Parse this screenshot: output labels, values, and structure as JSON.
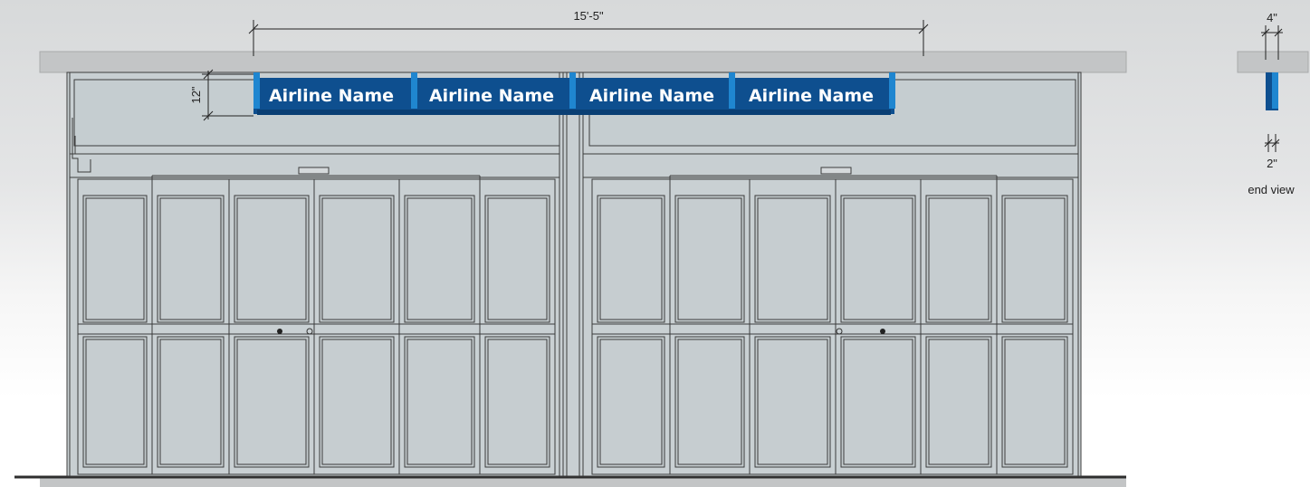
{
  "dimensions": {
    "overall_width": "15'-5\"",
    "sign_height": "12\"",
    "end_view_depth": "4\"",
    "end_view_thickness": "2\""
  },
  "sign": {
    "panels": [
      "Airline Name",
      "Airline Name",
      "Airline Name",
      "Airline Name"
    ],
    "color": "#0e4f8f",
    "accent_color": "#1f86d0"
  },
  "end_view": {
    "label": "end view"
  },
  "colors": {
    "glass": "#c6cdd0",
    "frame_line": "#3c3c3c",
    "canopy": "#c3c5c6",
    "floor": "#2e2e2e"
  }
}
